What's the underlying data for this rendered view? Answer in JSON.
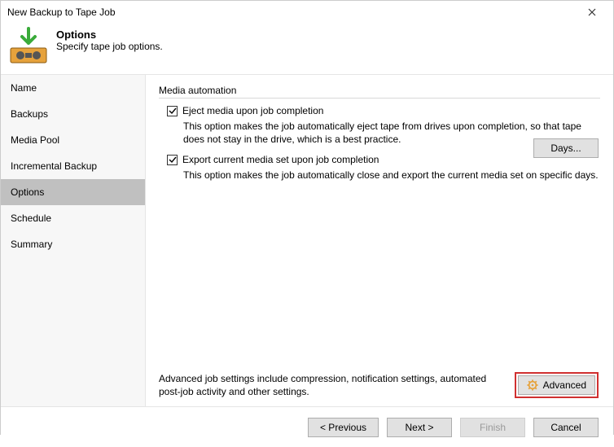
{
  "window": {
    "title": "New Backup to Tape Job"
  },
  "header": {
    "title": "Options",
    "subtitle": "Specify tape job options."
  },
  "sidebar": {
    "items": [
      {
        "label": "Name"
      },
      {
        "label": "Backups"
      },
      {
        "label": "Media Pool"
      },
      {
        "label": "Incremental Backup"
      },
      {
        "label": "Options"
      },
      {
        "label": "Schedule"
      },
      {
        "label": "Summary"
      }
    ],
    "selected_index": 4
  },
  "content": {
    "group_label": "Media automation",
    "eject": {
      "label": "Eject media upon job completion",
      "desc": "This option makes the job automatically eject tape from drives upon completion, so that tape does not stay in the drive, which is a best practice.",
      "checked": true
    },
    "export": {
      "label": "Export current media set upon job completion",
      "desc": "This option makes the job automatically close and export the current media set on specific days.",
      "checked": true,
      "days_button": "Days..."
    },
    "advanced": {
      "text": "Advanced job settings include compression, notification settings, automated post-job activity and other settings.",
      "button": "Advanced"
    }
  },
  "footer": {
    "previous": "< Previous",
    "next": "Next >",
    "finish": "Finish",
    "cancel": "Cancel"
  }
}
